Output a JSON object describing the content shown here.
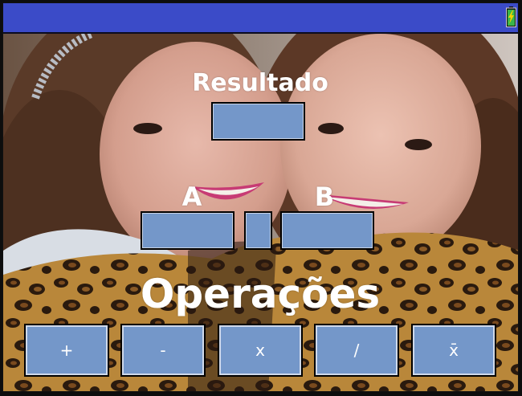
{
  "labels": {
    "result": "Resultado",
    "a": "A",
    "b": "B",
    "operations": "Operações"
  },
  "fields": {
    "result_value": "",
    "a_value": "",
    "operator_value": "",
    "b_value": ""
  },
  "buttons": [
    {
      "label": "+"
    },
    {
      "label": "-"
    },
    {
      "label": "x"
    },
    {
      "label": "/"
    },
    {
      "label": "x̄"
    }
  ],
  "colors": {
    "titlebar": "#3b4bc8",
    "field": "#7497c9",
    "text": "#ffffff",
    "battery": "#f2d400"
  },
  "icons": {
    "status": "battery-icon",
    "background": "photo-background"
  }
}
